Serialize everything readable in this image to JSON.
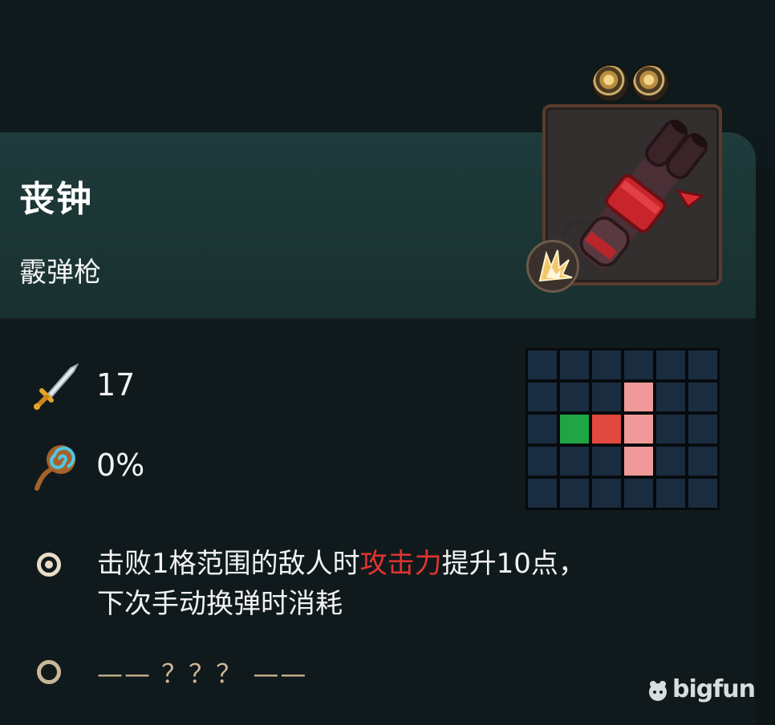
{
  "item": {
    "name": "丧钟",
    "type": "霰弹枪",
    "slots": [
      "bullet-slot-icon",
      "bullet-slot-icon"
    ],
    "element_icon": "explosion-icon"
  },
  "stats": [
    {
      "icon": "sword-icon",
      "value": "17"
    },
    {
      "icon": "spiral-staff-icon",
      "value": "0%"
    }
  ],
  "range_grid": {
    "rows": 5,
    "cols": 6,
    "cells": [
      [
        "n",
        "n",
        "n",
        "n",
        "n",
        "n"
      ],
      [
        "n",
        "n",
        "n",
        "pink",
        "n",
        "n"
      ],
      [
        "n",
        "green",
        "red",
        "pink",
        "n",
        "n"
      ],
      [
        "n",
        "n",
        "n",
        "pink",
        "n",
        "n"
      ],
      [
        "n",
        "n",
        "n",
        "n",
        "n",
        "n"
      ]
    ],
    "colors": {
      "n": "#1a2c3f",
      "pink": "#ef9a98",
      "green": "#1fa544",
      "red": "#e2493e"
    }
  },
  "effects": {
    "first": {
      "part1": "击败1格范围的敌人时",
      "highlight": "攻击力",
      "part2": "提升10点，",
      "line2": "下次手动换弹时消耗"
    },
    "locked": "—— ？？？ ——"
  },
  "watermark": "bigfun",
  "colors": {
    "highlight": "#e2342f",
    "header_band": "#1f3b3b",
    "background": "#101a1d"
  }
}
